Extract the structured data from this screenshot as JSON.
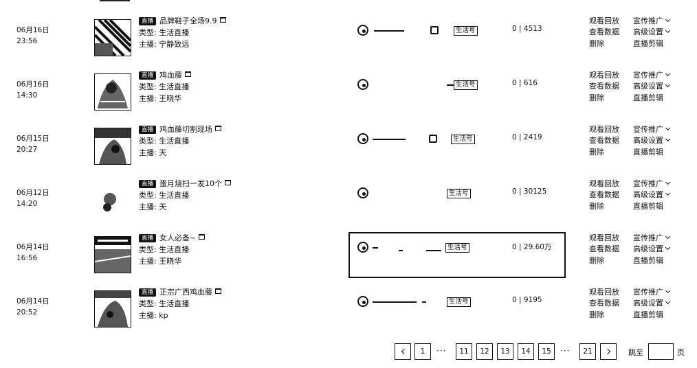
{
  "rows": [
    {
      "date": "06月16日",
      "time": "23:56",
      "badge": "直播",
      "title": "品牌鞋子全场9.9",
      "type": "类型: 生活直播",
      "host": "主播: 宁静致远",
      "tag": "生活号",
      "stats": "0 | 4513",
      "actions": [
        "观看回放",
        "宣传推广",
        "查看数据",
        "高级设置",
        "删除",
        "直播剪辑"
      ]
    },
    {
      "date": "06月16日",
      "time": "14:30",
      "badge": "直播",
      "title": "鸡血藤",
      "type": "类型: 生活直播",
      "host": "主播: 王晓华",
      "tag": "生活号",
      "stats": "0 | 616",
      "actions": [
        "观看回放",
        "宣传推广",
        "查看数据",
        "高级设置",
        "删除",
        "直播剪辑"
      ]
    },
    {
      "date": "06月15日",
      "time": "20:27",
      "badge": "直播",
      "title": "鸡血藤切割现场",
      "type": "类型: 生活直播",
      "host": "主播: 天",
      "tag": "生活号",
      "stats": "0 | 2419",
      "actions": [
        "观看回放",
        "宣传推广",
        "查看数据",
        "高级设置",
        "删除",
        "直播剪辑"
      ]
    },
    {
      "date": "06月12日",
      "time": "14:20",
      "badge": "直播",
      "title": "蛋月烧扫一发10个",
      "type": "类型: 生活直播",
      "host": "主播: 天",
      "tag": "生活号",
      "stats": "0 | 30125",
      "actions": [
        "观看回放",
        "宣传推广",
        "查看数据",
        "高级设置",
        "删除",
        "直播剪辑"
      ]
    },
    {
      "date": "06月14日",
      "time": "16:56",
      "badge": "直播",
      "title": "女人必备~",
      "type": "类型: 生活直播",
      "host": "主播: 王晓华",
      "tag": "生活号",
      "stats": "0 | 29.60万",
      "actions": [
        "观看回放",
        "宣传推广",
        "查看数据",
        "高级设置",
        "删除",
        "直播剪辑"
      ]
    },
    {
      "date": "06月14日",
      "time": "20:52",
      "badge": "直播",
      "title": "正宗广西鸡血藤",
      "type": "类型: 生活直播",
      "host": "主播: kp",
      "tag": "生活号",
      "stats": "0 | 9195",
      "actions": [
        "观看回放",
        "宣传推广",
        "查看数据",
        "高级设置",
        "删除",
        "直播剪辑"
      ]
    }
  ],
  "pagination": {
    "pages": [
      "1",
      "11",
      "12",
      "13",
      "14",
      "15",
      "21"
    ],
    "ellipsis": "···",
    "jump_label": "跳至",
    "page_unit": "页",
    "jump_value": ""
  },
  "icons": {
    "anchor": "circle-logo-icon",
    "prev": "chevron-left-icon",
    "next": "chevron-right-icon",
    "dropdown": "chevron-down-icon",
    "shop": "shop-icon"
  }
}
